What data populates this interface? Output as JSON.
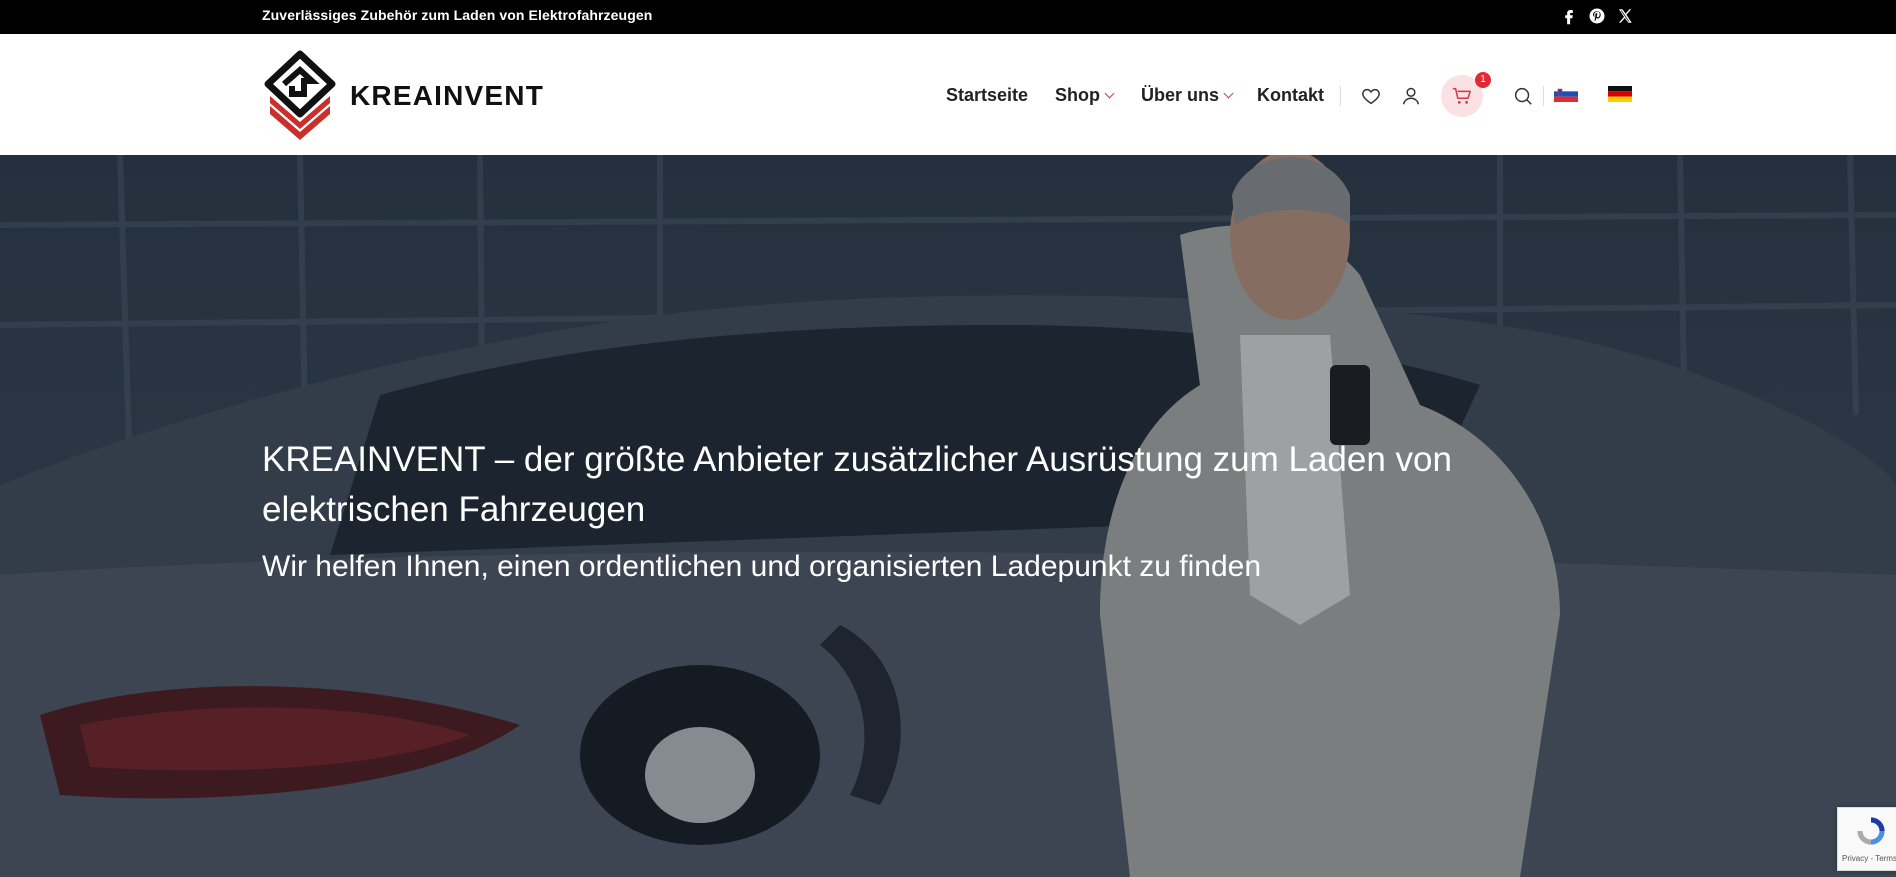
{
  "topbar": {
    "tagline": "Zuverlässiges Zubehör zum Laden von Elektrofahrzeugen",
    "social": [
      "facebook-icon",
      "pinterest-icon",
      "x-icon"
    ]
  },
  "header": {
    "logo_text": "KREAINVENT",
    "nav": [
      {
        "label": "Startseite",
        "dropdown": false
      },
      {
        "label": "Shop",
        "dropdown": true
      },
      {
        "label": "Über uns",
        "dropdown": true
      },
      {
        "label": "Kontakt",
        "dropdown": false
      }
    ],
    "icons": [
      "heart-icon",
      "user-icon",
      "cart-icon",
      "search-icon"
    ],
    "cart_count": "1",
    "flags": [
      "flag-slovenia",
      "flag-germany"
    ]
  },
  "hero": {
    "title": "KREAINVENT – der größte Anbieter zusätzlicher Ausrüstung zum Laden von elektrischen Fahrzeugen",
    "subtitle": "Wir helfen Ihnen, einen ordentlichen und organisierten Ladepunkt zu finden"
  },
  "recaptcha": {
    "text": "Privacy - Terms"
  },
  "colors": {
    "accent": "#d9363e",
    "cart_bg": "#fbe1e3",
    "topbar_bg": "#000000"
  }
}
